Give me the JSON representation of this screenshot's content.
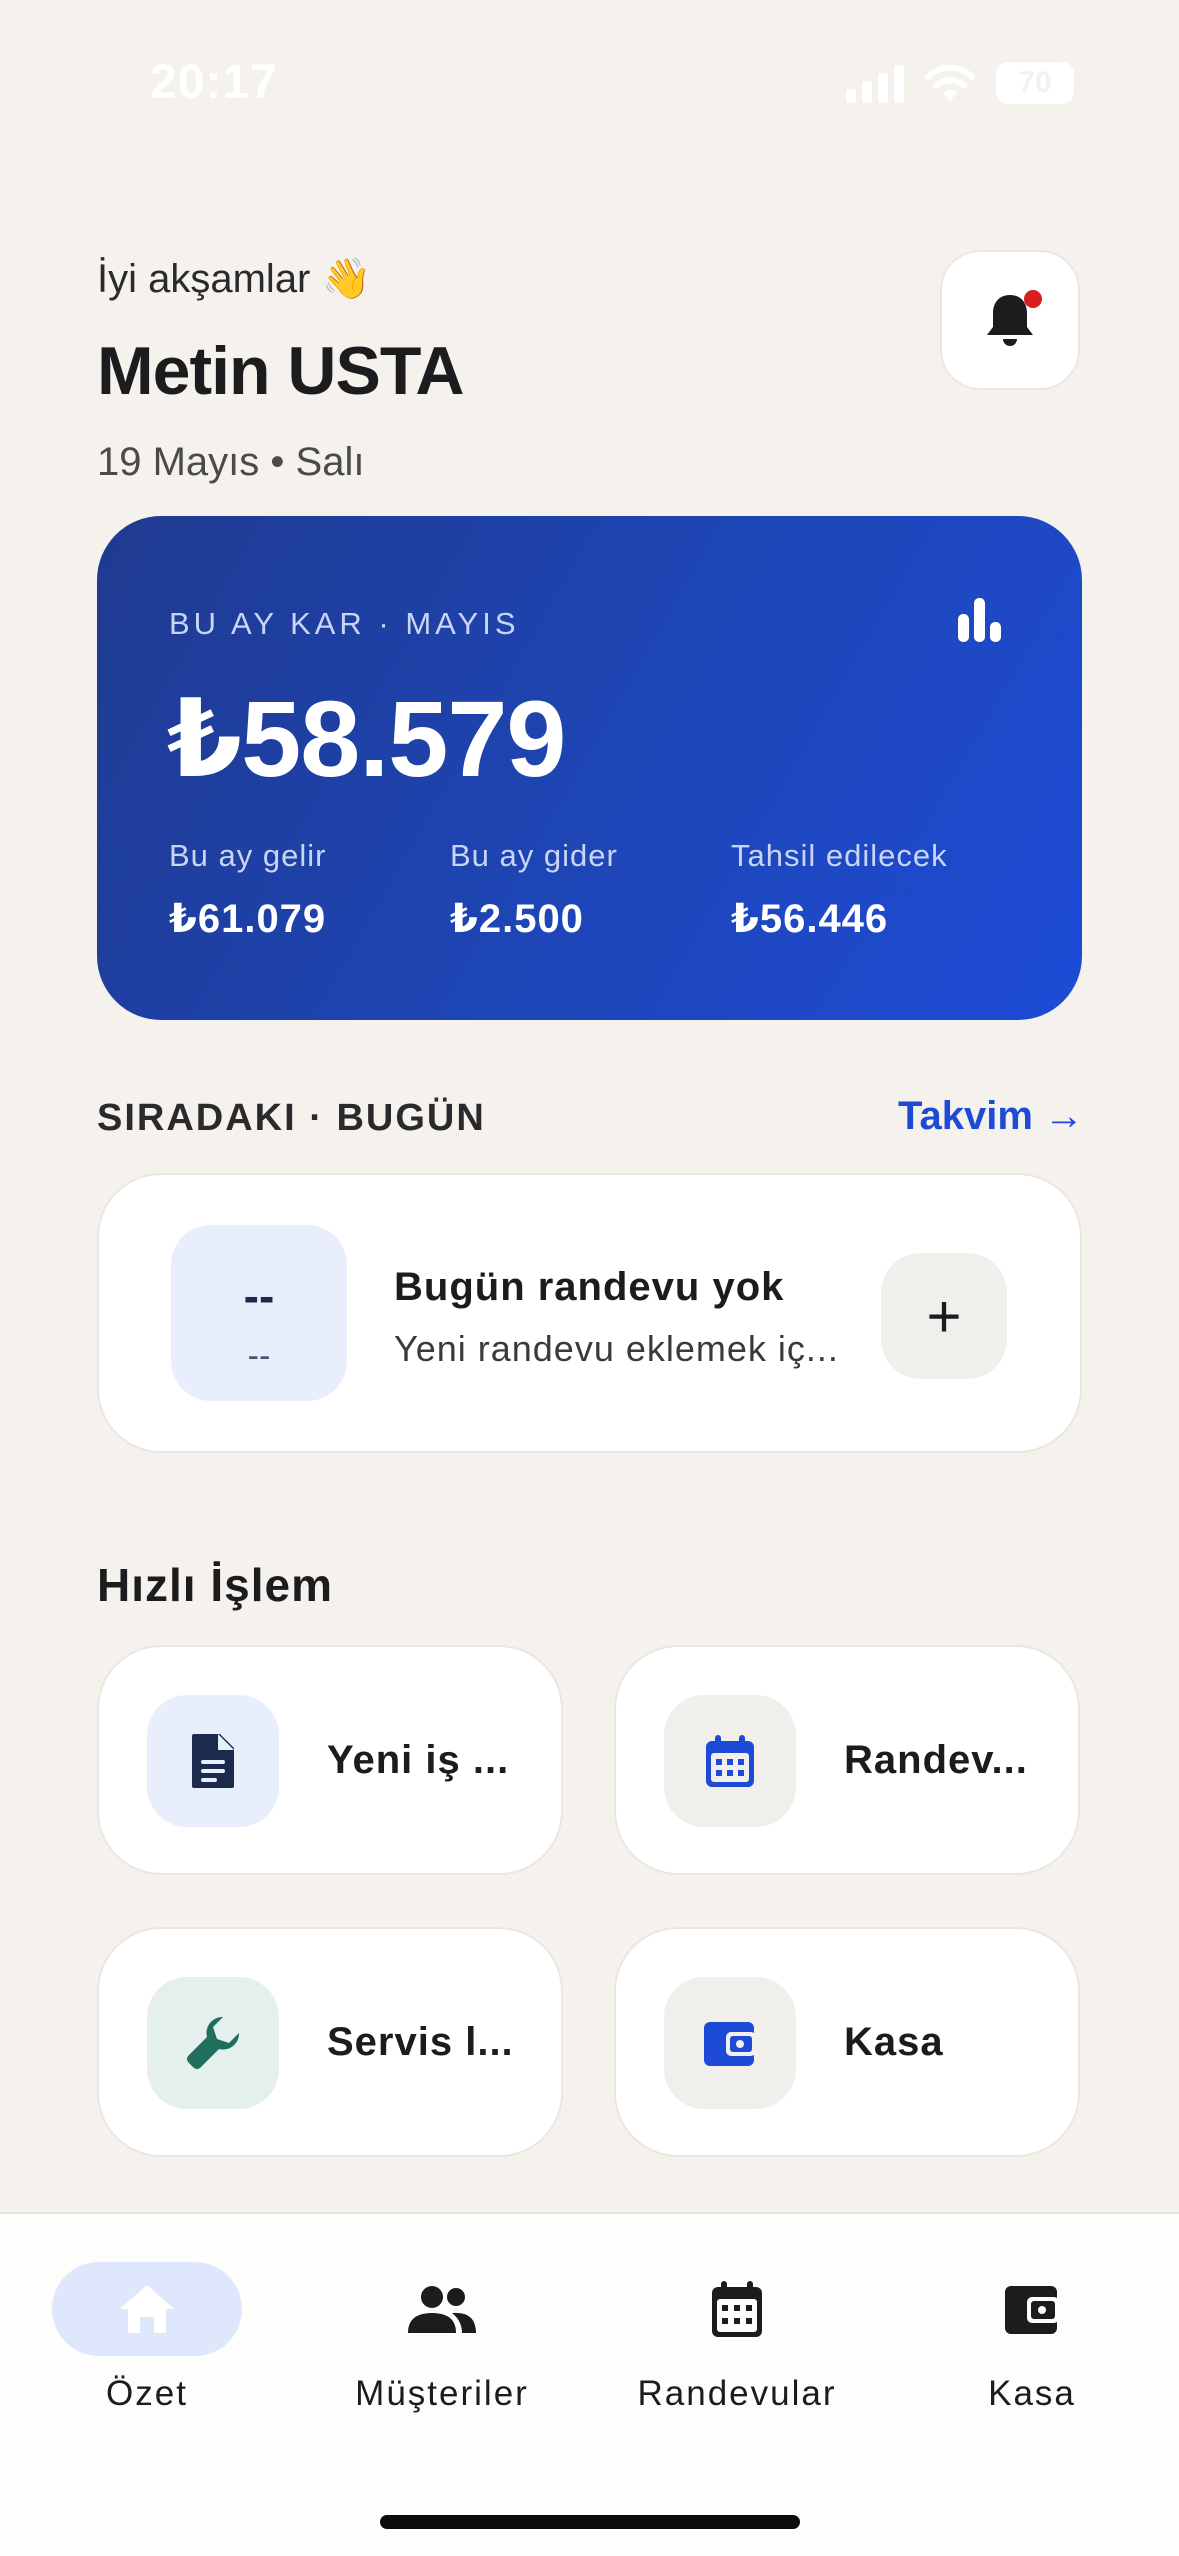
{
  "status_bar": {
    "time": "20:17",
    "battery": "70"
  },
  "header": {
    "greeting": "İyi akşamlar 👋",
    "user_name": "Metin USTA",
    "date": "19 Mayıs • Salı"
  },
  "profit_card": {
    "label": "BU AY KAR · MAYIS",
    "amount": "₺58.579",
    "stats": [
      {
        "label": "Bu ay gelir",
        "value": "₺61.079"
      },
      {
        "label": "Bu ay gider",
        "value": "₺2.500"
      },
      {
        "label": "Tahsil edilecek",
        "value": "₺56.446"
      }
    ]
  },
  "next_section": {
    "title": "SIRADAKI · BUGÜN",
    "link": "Takvim →",
    "time_main": "--",
    "time_sub": "--",
    "card_title": "Bugün randevu yok",
    "card_sub": "Yeni randevu eklemek iç...",
    "add_symbol": "+"
  },
  "quick_actions": {
    "title": "Hızlı İşlem",
    "items": [
      {
        "label": "Yeni iş ...",
        "icon": "document-icon",
        "color": "#1c2a4d",
        "bg": "#e8eefc"
      },
      {
        "label": "Randev...",
        "icon": "calendar-icon",
        "color": "#1d4bd6",
        "bg": "#f1efec"
      },
      {
        "label": "Servis l...",
        "icon": "wrench-icon",
        "color": "#1f6e5e",
        "bg": "#e5efeb"
      },
      {
        "label": "Kasa",
        "icon": "wallet-icon",
        "color": "#1d4bd6",
        "bg": "#f1efec"
      }
    ]
  },
  "bottom_nav": {
    "items": [
      {
        "label": "Özet",
        "icon": "home-icon",
        "active": true
      },
      {
        "label": "Müşteriler",
        "icon": "users-icon",
        "active": false
      },
      {
        "label": "Randevular",
        "icon": "calendar-icon",
        "active": false
      },
      {
        "label": "Kasa",
        "icon": "wallet-icon",
        "active": false
      }
    ]
  },
  "colors": {
    "accent": "#1d4bd6",
    "background": "#f5f2ee",
    "card": "#ffffff",
    "notification_dot": "#d71f1f"
  }
}
